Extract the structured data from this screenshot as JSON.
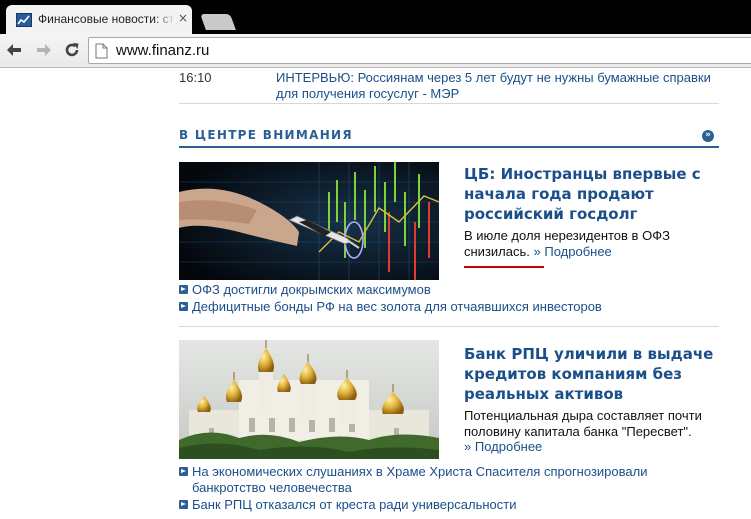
{
  "browser": {
    "tab_title": "Финансовые новости: ста",
    "tab_close": "×",
    "url": "www.finanz.ru"
  },
  "news_item": {
    "time": "16:10",
    "text": "ИНТЕРВЬЮ: Россиянам через 5 лет будут не нужны бумажные справки для получения госуслуг - МЭР"
  },
  "section": {
    "title": "В ЦЕНТРЕ ВНИМАНИЯ",
    "more_icon": "»"
  },
  "articles": [
    {
      "title": "ЦБ: Иностранцы впервые с начала года продают российский госдолг",
      "desc": "В июле доля нерезидентов в ОФЗ снизилась.",
      "more_label": "Подробнее",
      "more_arrow": "»",
      "image": "stock-chart-pen-photo",
      "related": [
        "ОФЗ достигли докрымских максимумов",
        "Дефицитные бонды РФ на вес золота для отчаявшихся инвесторов"
      ]
    },
    {
      "title": "Банк РПЦ уличили в выдаче кредитов компаниям без реальных активов",
      "desc": "Потенциальная дыра составляет почти половину капитала банка \"Пересвет\".",
      "more_label": "Подробнее",
      "more_arrow": "»",
      "image": "kremlin-cathedral-domes-photo",
      "related": [
        "На экономических слушаниях в Храме Христа Спасителя спрогнозировали банкротство человечества",
        "Банк РПЦ отказался от креста ради универсальности"
      ]
    }
  ],
  "colors": {
    "link": "#1b4f8a",
    "accent": "#2a6195",
    "highlight": "#cc0000"
  }
}
